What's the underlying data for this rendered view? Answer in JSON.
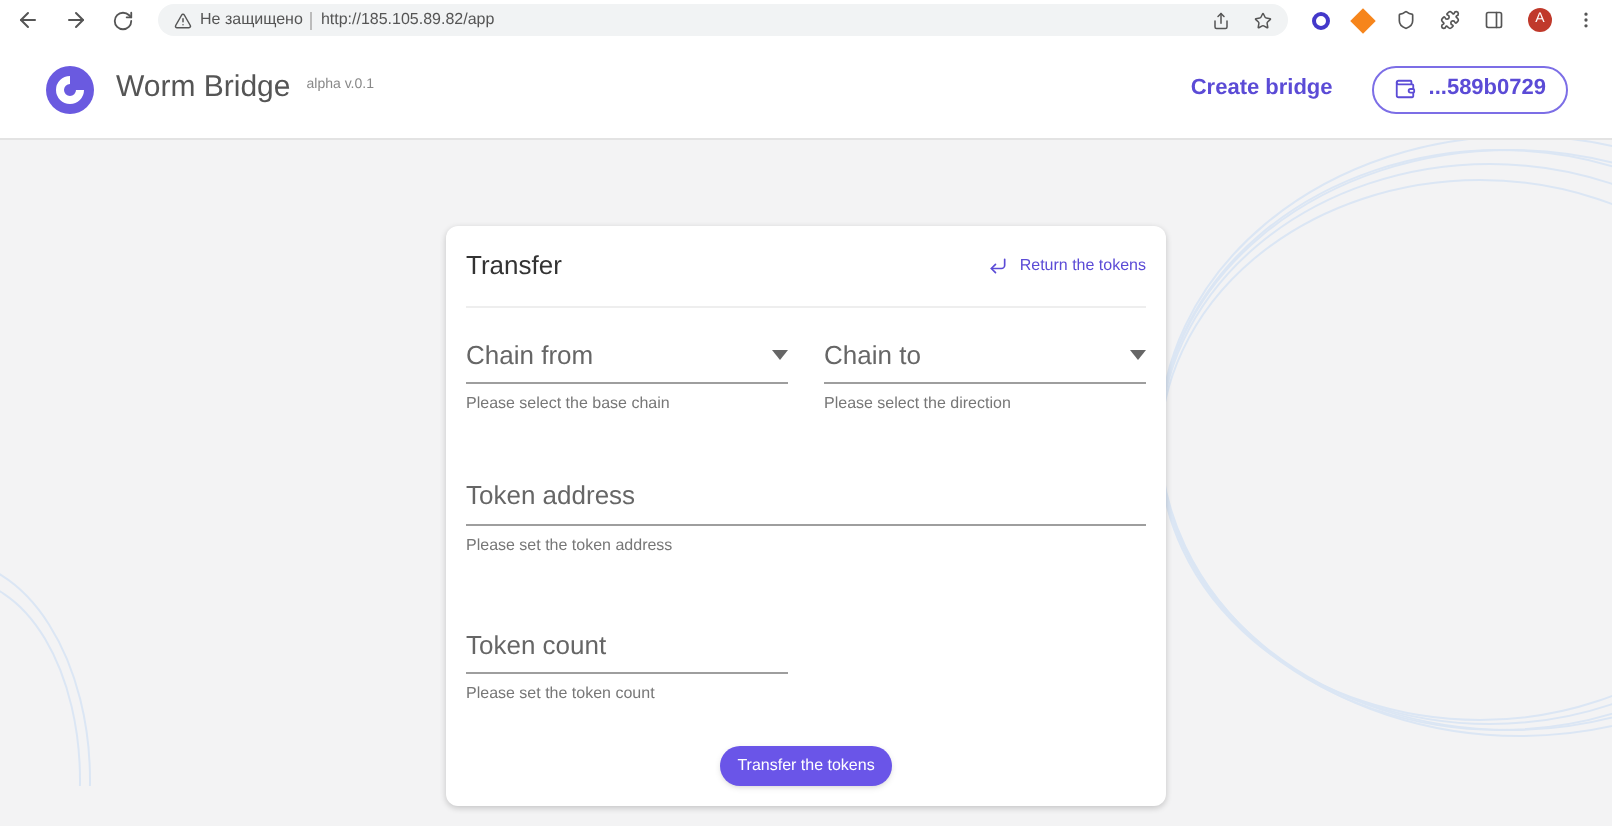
{
  "browser": {
    "security": "Не защищено",
    "url": "http://185.105.89.82/app",
    "profile": "A"
  },
  "header": {
    "app_name": "Worm Bridge",
    "version": "alpha v.0.1",
    "create_link": "Create bridge",
    "wallet": "...589b0729"
  },
  "card": {
    "title": "Transfer",
    "return_link": "Return the tokens",
    "fields": [
      {
        "kind": "select",
        "label": "Chain from",
        "helper": "Please select the base chain"
      },
      {
        "kind": "select",
        "label": "Chain to",
        "helper": "Please select the direction"
      },
      {
        "kind": "text",
        "label": "Token address",
        "helper": "Please set the token address",
        "wide": true
      },
      {
        "kind": "text",
        "label": "Token count",
        "helper": "Please set the token count",
        "wide": false
      }
    ],
    "submit": "Transfer the tokens"
  }
}
